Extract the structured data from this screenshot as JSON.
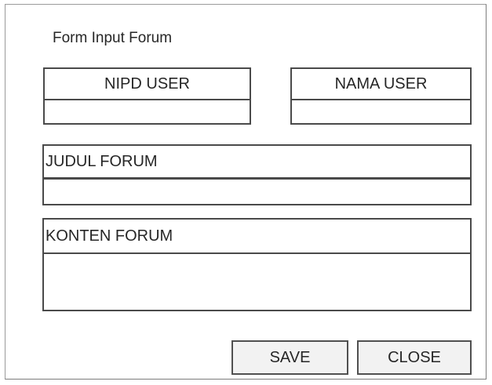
{
  "form": {
    "title": "Form Input Forum",
    "fields": {
      "nipd_user": {
        "label": "NIPD USER",
        "value": ""
      },
      "nama_user": {
        "label": "NAMA USER",
        "value": ""
      },
      "judul_forum": {
        "label": "JUDUL FORUM",
        "value": ""
      },
      "konten_forum": {
        "label": "KONTEN FORUM",
        "value": ""
      }
    },
    "buttons": {
      "save_label": "SAVE",
      "close_label": "CLOSE"
    }
  }
}
